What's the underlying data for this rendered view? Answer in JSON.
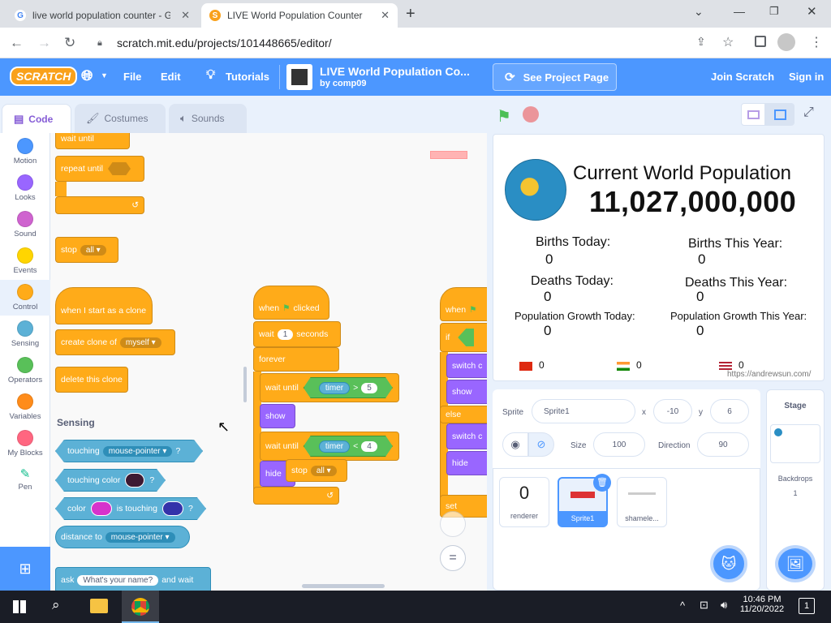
{
  "browser": {
    "tabs": [
      {
        "title": "live world population counter - G"
      },
      {
        "title": "LIVE World Population Counter o"
      }
    ],
    "url": "scratch.mit.edu/projects/101448665/editor/"
  },
  "menubar": {
    "logo": "SCRATCH",
    "file": "File",
    "edit": "Edit",
    "tutorials": "Tutorials",
    "project_title": "LIVE World Population Co...",
    "project_author": "by comp09",
    "see_project": "See Project Page",
    "join": "Join Scratch",
    "signin": "Sign in"
  },
  "editor_tabs": {
    "code": "Code",
    "costumes": "Costumes",
    "sounds": "Sounds"
  },
  "categories": [
    {
      "label": "Motion",
      "color": "#4c97ff"
    },
    {
      "label": "Looks",
      "color": "#9966ff"
    },
    {
      "label": "Sound",
      "color": "#cf63cf"
    },
    {
      "label": "Events",
      "color": "#ffd500"
    },
    {
      "label": "Control",
      "color": "#ffab19"
    },
    {
      "label": "Sensing",
      "color": "#5cb1d6"
    },
    {
      "label": "Operators",
      "color": "#59c059"
    },
    {
      "label": "Variables",
      "color": "#ff8c1a"
    },
    {
      "label": "My Blocks",
      "color": "#ff6680"
    },
    {
      "label": "Pen",
      "color": "#0fbd8c"
    }
  ],
  "palette": {
    "wait_until": "wait until",
    "repeat_until": "repeat until",
    "stop": "stop",
    "stop_all": "all",
    "clone_start": "when I start as a clone",
    "create_clone": "create clone of",
    "create_clone_target": "myself",
    "delete_clone": "delete this clone",
    "sensing_heading": "Sensing",
    "touching": "touching",
    "touching_target": "mouse-pointer",
    "q": "?",
    "touching_color": "touching color",
    "color": "color",
    "is_touching": "is touching",
    "distance_to": "distance to",
    "distance_target": "mouse-pointer",
    "ask": "ask",
    "ask_default": "What's your name?",
    "and_wait": "and wait"
  },
  "script": {
    "when": "when",
    "clicked": "clicked",
    "wait": "wait",
    "wait_val": "1",
    "seconds": "seconds",
    "forever": "forever",
    "wait_until": "wait until",
    "timer": "timer",
    "gt": ">",
    "val5": "5",
    "show": "show",
    "lt": "<",
    "val4": "4",
    "hide": "hide",
    "stop": "stop",
    "stop_all": "all",
    "when2": "when",
    "if": "if",
    "switch": "switch c",
    "show2": "show",
    "else": "else",
    "switch2": "switch c",
    "hide2": "hide",
    "set": "set",
    "zoom_reset": "="
  },
  "stage": {
    "title": "Current World Population",
    "population": "11,027,000,000",
    "births_today": "Births Today:",
    "births_today_val": "0",
    "births_year": "Births This Year:",
    "births_year_val": "0",
    "deaths_today": "Deaths Today:",
    "deaths_today_val": "0",
    "deaths_year": "Deaths This Year:",
    "deaths_year_val": "0",
    "growth_today": "Population Growth Today:",
    "growth_today_val": "0",
    "growth_year": "Population Growth This Year:",
    "growth_year_val": "0",
    "china_val": "0",
    "india_val": "0",
    "usa_val": "0",
    "credit": "https://andrewsun.com/"
  },
  "sprite_info": {
    "sprite_label": "Sprite",
    "sprite_name": "Sprite1",
    "x_label": "x",
    "x_val": "-10",
    "y_label": "y",
    "y_val": "6",
    "show_label": "Show",
    "size_label": "Size",
    "size_val": "100",
    "direction_label": "Direction",
    "direction_val": "90"
  },
  "sprites": [
    {
      "name": "renderer",
      "thumb_text": "0"
    },
    {
      "name": "Sprite1"
    },
    {
      "name": "shamele..."
    }
  ],
  "stage_panel": {
    "title": "Stage",
    "backdrops": "Backdrops",
    "count": "1"
  },
  "taskbar": {
    "time": "10:46 PM",
    "date": "11/20/2022",
    "notif": "1"
  }
}
